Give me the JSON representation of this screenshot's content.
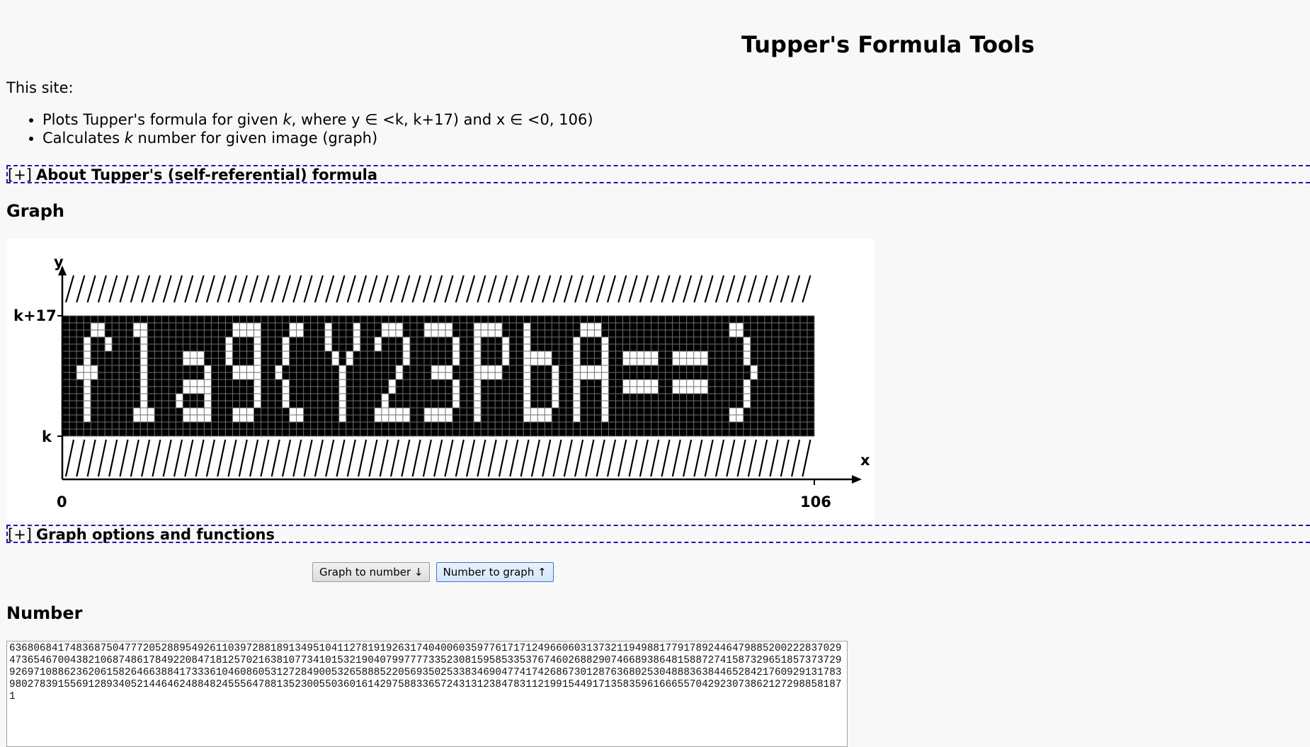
{
  "header": {
    "title": "Tupper's Formula Tools"
  },
  "intro": {
    "lead": "This site:",
    "items": [
      {
        "pre": "Plots Tupper's formula for given ",
        "var": "k",
        "post": ", where y ∈ <k, k+17) and x ∈ <0, 106)"
      },
      {
        "pre": "Calculates ",
        "var": "k",
        "post": " number for given image (graph)"
      }
    ]
  },
  "about": {
    "toggle": "[+]",
    "label": "About Tupper's (self-referential) formula"
  },
  "graph": {
    "heading": "Graph",
    "axis": {
      "y_label": "y",
      "x_label": "x",
      "k_top": "k+17",
      "k_bottom": "k",
      "x_start": "0",
      "x_end": "106"
    },
    "grid": {
      "columns": 106,
      "rows": 17
    },
    "bitmap_text": "flag{Y23pbA==}",
    "colors": {
      "on": "#ffffff",
      "off": "#000000",
      "grid": "#6e6e6e"
    }
  },
  "options": {
    "toggle": "[+]",
    "label": "Graph options and functions"
  },
  "buttons": {
    "graph_to_number": "Graph to number ↓",
    "number_to_graph": "Number to graph ↑"
  },
  "number": {
    "heading": "Number",
    "value": "636806841748368750477720528895492611039728818913495104112781919263174040060359776171712496606031373211949881779178924464798852002228370294736546700438210687486178492208471812570216381077341015321904079977773352308159585335376746026882907466893864815887274158732965185737372992697108862362061582646638841733361046086053127284900532658885220569350253383469047741742686730128763680253048883638446528421760929131783980278391556912893405214464624884824555647881352300550360161429758833657243131238478311219915449171358359616665570429230738621272988581871"
  }
}
